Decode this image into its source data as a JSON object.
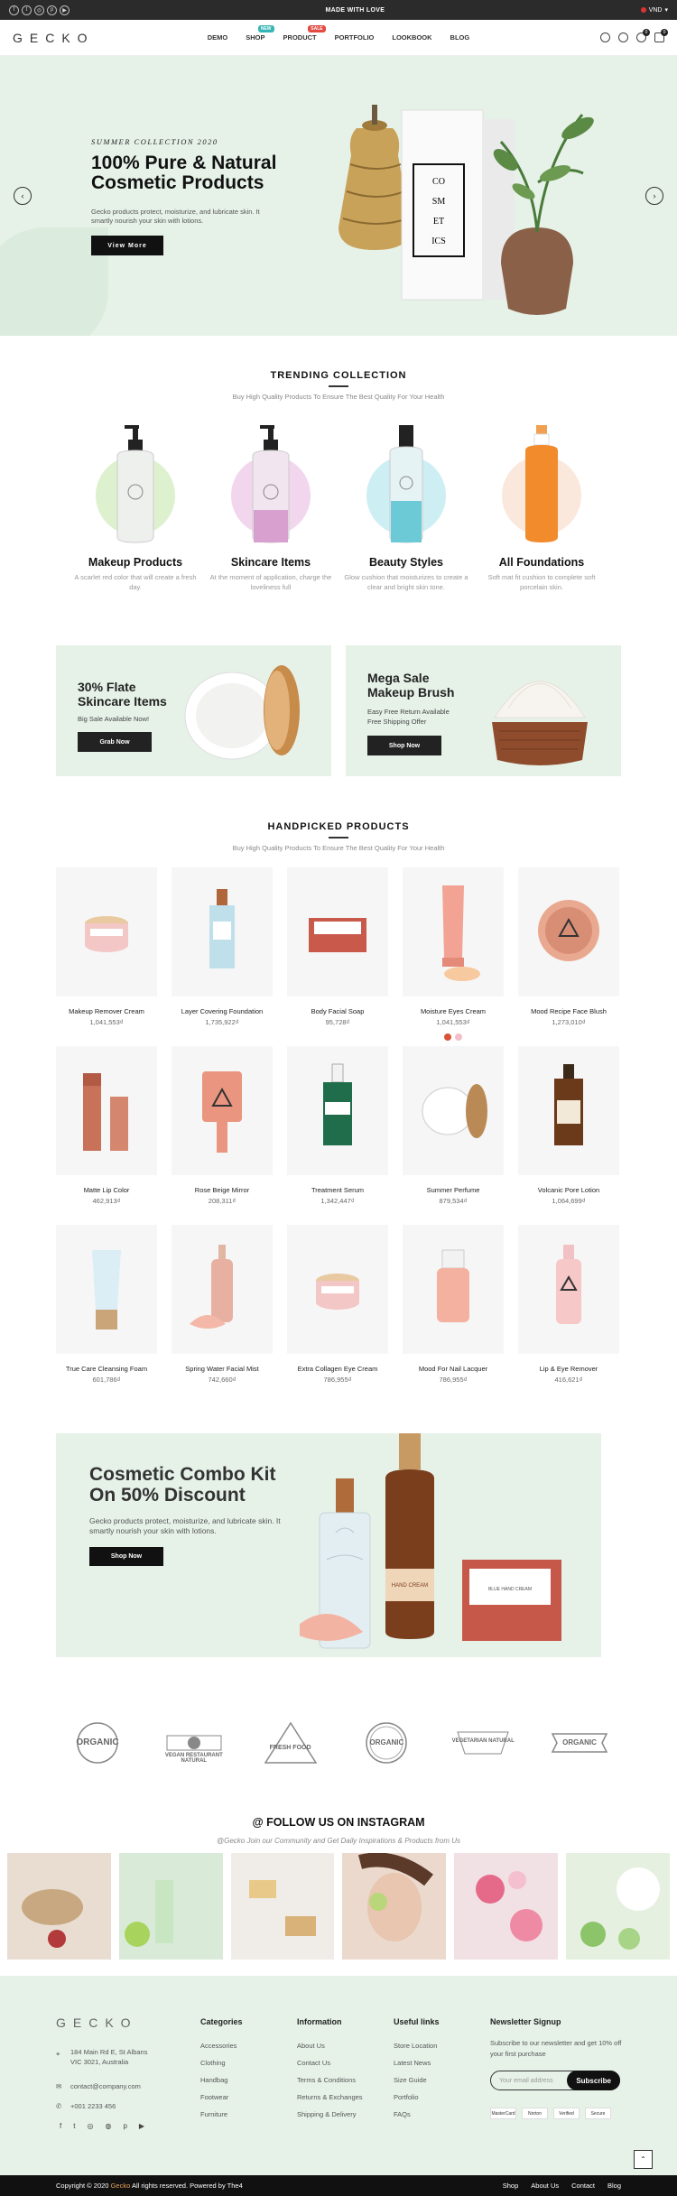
{
  "topbar": {
    "message": "MADE WITH LOVE",
    "currency": "VND",
    "socials": [
      "f",
      "t",
      "ig",
      "p",
      "yt"
    ]
  },
  "header": {
    "logo": "GECKO",
    "nav": [
      {
        "label": "DEMO",
        "tag": "",
        "tag_color": ""
      },
      {
        "label": "SHOP",
        "tag": "NEW",
        "tag_color": "#35b5b5"
      },
      {
        "label": "PRODUCT",
        "tag": "SALE",
        "tag_color": "#e24a42"
      },
      {
        "label": "PORTFOLIO",
        "tag": "",
        "tag_color": ""
      },
      {
        "label": "LOOKBOOK",
        "tag": "",
        "tag_color": ""
      },
      {
        "label": "BLOG",
        "tag": "",
        "tag_color": ""
      }
    ],
    "wishlist_count": "0",
    "cart_count": "0"
  },
  "hero": {
    "subtitle": "SUMMER COLLECTION 2020",
    "title": "100% Pure & Natural Cosmetic Products",
    "description": "Gecko products protect, moisturize, and lubricate skin. It smartly nourish your skin with lotions.",
    "button": "View More",
    "box_text": [
      "CO",
      "SM",
      "ET",
      "ICS"
    ],
    "prev": "‹",
    "next": "›"
  },
  "trending": {
    "title": "TRENDING COLLECTION",
    "subtitle": "Buy High Quality Products To Ensure The Best Quality For Your Health",
    "items": [
      {
        "name": "Makeup Products",
        "desc": "A scarlet red color that will create a fresh day.",
        "circle": "#ddf1cf",
        "bottle": "#2b2b2b"
      },
      {
        "name": "Skincare Items",
        "desc": "At the moment of application, charge the loveliness full",
        "circle": "#f1d6ee",
        "bottle": "#2b2b2b"
      },
      {
        "name": "Beauty Styles",
        "desc": "Glow cushion that moisturizes to create a clear and bright skin tone.",
        "circle": "#cdeef3",
        "bottle": "#2b2b2b"
      },
      {
        "name": "All Foundations",
        "desc": "Soft mat fit cushion to complete soft porcelain skin.",
        "circle": "#fbe8dc",
        "bottle": "#f28b2c"
      }
    ]
  },
  "banners": [
    {
      "title": "30% Flate\nSkincare Items",
      "subtitle": "Big Sale Available Now!",
      "button": "Grab Now"
    },
    {
      "title": "Mega Sale\nMakeup Brush",
      "subtitle": "Easy Free Return Available\nFree Shipping Offer",
      "button": "Shop Now"
    }
  ],
  "handpicked": {
    "title": "HANDPICKED PRODUCTS",
    "subtitle": "Buy High Quality Products To Ensure The Best Quality For Your Health",
    "products": [
      {
        "name": "Makeup Remover Cream",
        "price": "1,041,553₫",
        "icon": "jar"
      },
      {
        "name": "Layer Covering Foundation",
        "price": "1,735,922₫",
        "icon": "bottle"
      },
      {
        "name": "Body Facial Soap",
        "price": "95,728₫",
        "icon": "soap"
      },
      {
        "name": "Moisture Eyes Cream",
        "price": "1,041,553₫",
        "icon": "tube"
      },
      {
        "name": "Mood Recipe Face Blush",
        "price": "1,273,010₫",
        "icon": "compact"
      },
      {
        "name": "Matte Lip Color",
        "price": "462,913₫",
        "icon": "lipstick"
      },
      {
        "name": "Rose Beige Mirror",
        "price": "208,311₫",
        "icon": "mirror"
      },
      {
        "name": "Treatment Serum",
        "price": "1,342,447₫",
        "icon": "serum"
      },
      {
        "name": "Summer Perfume",
        "price": "879,534₫",
        "icon": "cream"
      },
      {
        "name": "Volcanic Pore Lotion",
        "price": "1,064,699₫",
        "icon": "lotion"
      },
      {
        "name": "True Care Cleansing Foam",
        "price": "601,786₫",
        "icon": "foam"
      },
      {
        "name": "Spring Water Facial Mist",
        "price": "742,660₫",
        "icon": "mist"
      },
      {
        "name": "Extra Collagen Eye Cream",
        "price": "786,955₫",
        "icon": "jar"
      },
      {
        "name": "Mood For Nail Lacquer",
        "price": "786,955₫",
        "icon": "nail"
      },
      {
        "name": "Lip & Eye Remover",
        "price": "416,621₫",
        "icon": "remover"
      }
    ],
    "swatches": [
      "#d9533a",
      "#f3bfcb"
    ]
  },
  "combo": {
    "title": "Cosmetic Combo Kit\nOn 50% Discount",
    "description": "Gecko products protect, moisturize, and lubricate skin. It smartly nourish your skin with lotions.",
    "button": "Shop Now",
    "cream_label": "HAND CREAM",
    "soap_label": "BLUE HAND CREAM"
  },
  "brands": [
    "ORGANIC",
    "VEGAN RESTAURANT NATURAL",
    "FRESH FOOD",
    "ORGANIC",
    "VEGETARIAN NATURAL",
    "ORGANIC"
  ],
  "instagram": {
    "title": "@ FOLLOW US ON INSTAGRAM",
    "subtitle": "@Gecko Join our Community and Get Daily Inspirations & Products from Us",
    "photos": [
      "#e9ddd2",
      "#d9ebd8",
      "#f0ece7",
      "#ead9cc",
      "#f2e1e4",
      "#e6f0e1"
    ]
  },
  "footer": {
    "logo": "GECKO",
    "address": "184 Main Rd E, St Albans\nVIC 3021, Australia",
    "email": "contact@company.com",
    "phone": "+001 2233 456",
    "categories_title": "Categories",
    "categories": [
      "Accessories",
      "Clothing",
      "Handbag",
      "Footwear",
      "Furniture"
    ],
    "information_title": "Information",
    "information": [
      "About Us",
      "Contact Us",
      "Terms & Conditions",
      "Returns & Exchanges",
      "Shipping & Delivery"
    ],
    "links_title": "Useful links",
    "links": [
      "Store Location",
      "Latest News",
      "Size Guide",
      "Portfolio",
      "FAQs"
    ],
    "newsletter_title": "Newsletter Signup",
    "newsletter_desc": "Subscribe to our newsletter and get 10% off your first purchase",
    "email_placeholder": "Your email address",
    "subscribe": "Subscribe",
    "payments": [
      "MasterCard",
      "Norton",
      "Verified",
      "Secure"
    ]
  },
  "bottom": {
    "copyright_prefix": "Copyright © 2020",
    "brand": "Gecko",
    "copyright_suffix": "All rights reserved. Powered by The4",
    "links": [
      "Shop",
      "About Us",
      "Contact",
      "Blog"
    ]
  }
}
